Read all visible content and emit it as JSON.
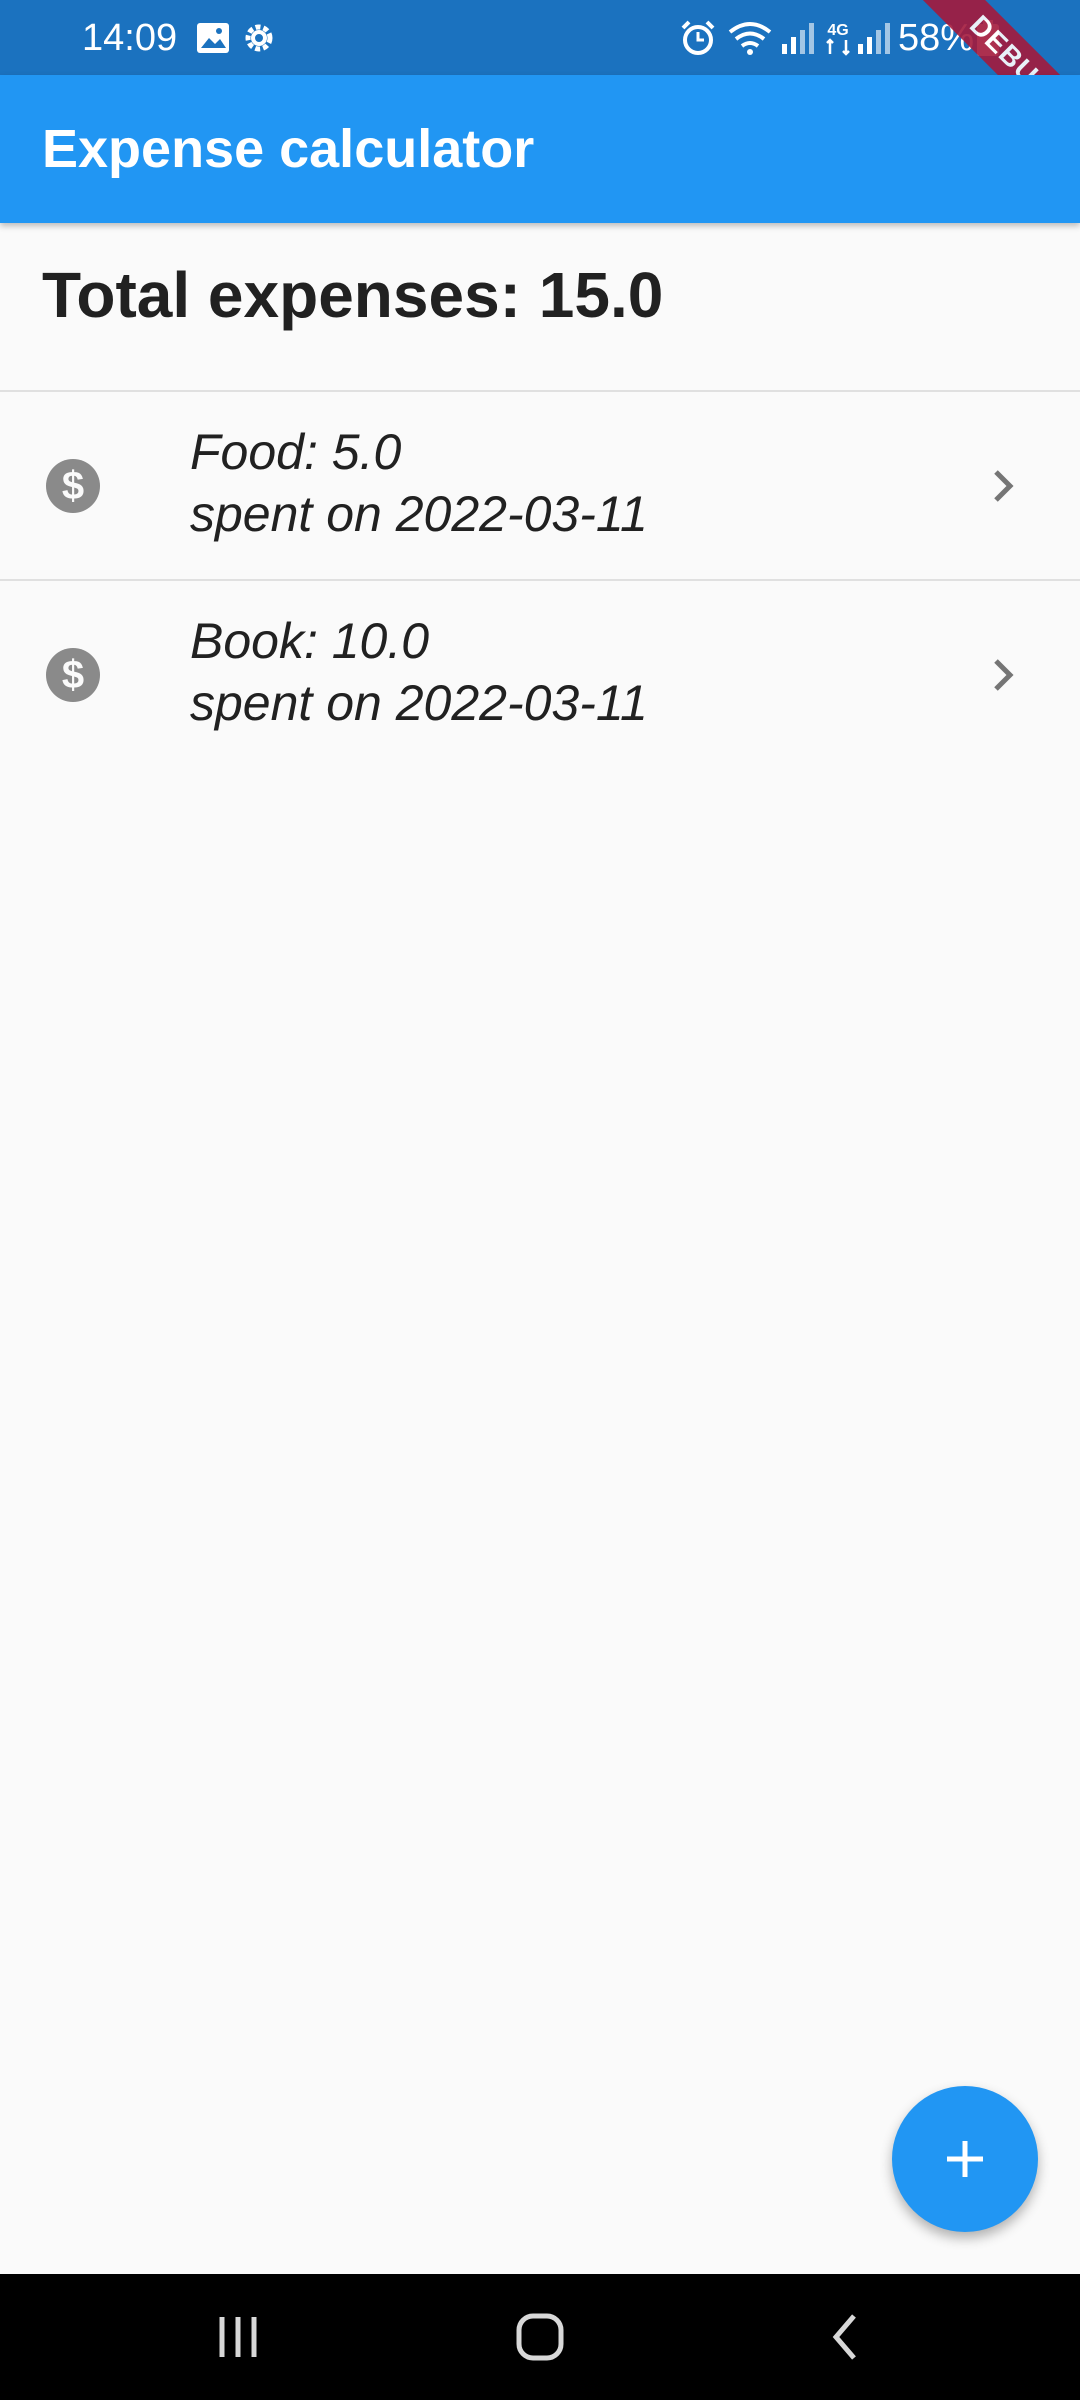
{
  "status_bar": {
    "time": "14:09",
    "battery": "58%",
    "icons": [
      "image-icon",
      "settings-icon",
      "alarm-icon",
      "wifi-icon",
      "signal-icon",
      "4g-icon",
      "signal-icon",
      "battery-icon"
    ]
  },
  "debug_banner": "DEBUG",
  "app_bar": {
    "title": "Expense calculator"
  },
  "total": {
    "label": "Total expenses: 15.0"
  },
  "expenses": [
    {
      "title": "Food: 5.0",
      "subtitle": "spent on 2022-03-11",
      "icon": "dollar-coin-icon"
    },
    {
      "title": "Book: 10.0",
      "subtitle": "spent on 2022-03-11",
      "icon": "dollar-coin-icon"
    }
  ],
  "fab": {
    "icon": "plus-icon"
  },
  "nav": {
    "buttons": [
      "recents-icon",
      "home-icon",
      "back-icon"
    ]
  },
  "colors": {
    "primary": "#2196f3",
    "status_bar": "#1b72bf",
    "background": "#fafafa",
    "icon_gray": "#8a8a8a"
  }
}
